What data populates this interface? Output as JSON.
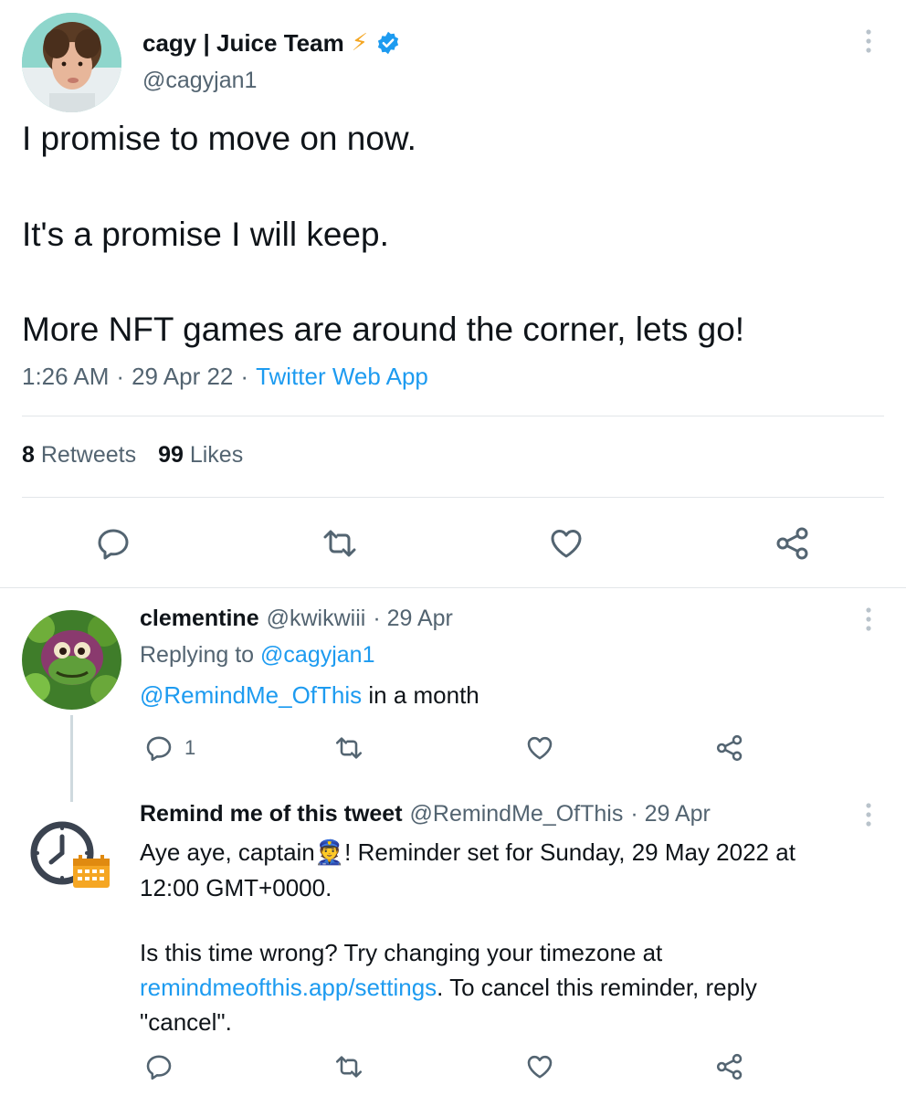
{
  "main_tweet": {
    "author_name": "cagy | Juice Team",
    "author_emoji": "⚡",
    "handle": "@cagyjan1",
    "lines": [
      "I promise to move on now.",
      "It's a promise I will keep.",
      "More NFT games are around the corner, lets go!"
    ],
    "time": "1:26 AM",
    "date": "29 Apr 22",
    "separator": "·",
    "source": "Twitter Web App",
    "retweets_count": "8",
    "retweets_label": "Retweets",
    "likes_count": "99",
    "likes_label": "Likes"
  },
  "reply1": {
    "author_name": "clementine",
    "handle": "@kwikwiii",
    "date": "· 29 Apr",
    "replying_prefix": "Replying to",
    "replying_to": "@cagyjan1",
    "mention": "@RemindMe_OfThis",
    "text": " in a month",
    "reply_count": "1"
  },
  "reply2": {
    "author_name": "Remind me of this tweet",
    "handle": "@RemindMe_OfThis",
    "date": "· 29 Apr",
    "line1_a": "Aye aye, captain",
    "line1_emoji": "👮",
    "line1_b": "! Reminder set for Sunday, 29 May 2022 at",
    "line2": "12:00 GMT+0000.",
    "line3": "Is this time wrong? Try changing your timezone at",
    "line4_link": "remindmeofthis.app/settings",
    "line4_rest": ". To cancel this reminder, reply",
    "line5": "\"cancel\"."
  },
  "colors": {
    "accent": "#1d9bf0",
    "text": "#0f1419",
    "muted": "#536471",
    "verified": "#1d9bf0",
    "bolt": "#f4a623"
  }
}
